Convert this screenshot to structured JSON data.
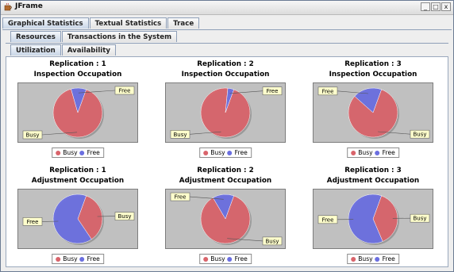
{
  "window": {
    "title": "JFrame",
    "buttons": [
      "_",
      "□",
      "x"
    ]
  },
  "tabs_level1": [
    "Graphical Statistics",
    "Textual Statistics",
    "Trace"
  ],
  "tabs_level2": [
    "Resources",
    "Transactions in the System"
  ],
  "tabs_level3": [
    "Utilization",
    "Availability"
  ],
  "colors": {
    "busy": "#d9646b",
    "free": "#6b6fe0",
    "plot_bg": "#c0c0c0"
  },
  "legend": {
    "busy": "Busy",
    "free": "Free"
  },
  "charts": [
    {
      "line1": "Replication :  1",
      "line2": "Inspection Occupation"
    },
    {
      "line1": "Replication :  2",
      "line2": "Inspection Occupation"
    },
    {
      "line1": "Replication :  3",
      "line2": "Inspection Occupation"
    },
    {
      "line1": "Replication :  1",
      "line2": "Adjustment Occupation"
    },
    {
      "line1": "Replication :  2",
      "line2": "Adjustment Occupation"
    },
    {
      "line1": "Replication :  3",
      "line2": "Adjustment Occupation"
    }
  ],
  "chart_data": [
    {
      "type": "pie",
      "title": "Inspection Occupation",
      "subtitle": "Replication :  1",
      "labels": [
        "Busy",
        "Free"
      ],
      "values": [
        90,
        10
      ]
    },
    {
      "type": "pie",
      "title": "Inspection Occupation",
      "subtitle": "Replication :  2",
      "labels": [
        "Busy",
        "Free"
      ],
      "values": [
        96,
        4
      ]
    },
    {
      "type": "pie",
      "title": "Inspection Occupation",
      "subtitle": "Replication :  3",
      "labels": [
        "Busy",
        "Free"
      ],
      "values": [
        81,
        19
      ]
    },
    {
      "type": "pie",
      "title": "Adjustment Occupation",
      "subtitle": "Replication :  1",
      "labels": [
        "Busy",
        "Free"
      ],
      "values": [
        35,
        65
      ]
    },
    {
      "type": "pie",
      "title": "Adjustment Occupation",
      "subtitle": "Replication :  2",
      "labels": [
        "Busy",
        "Free"
      ],
      "values": [
        86,
        14
      ]
    },
    {
      "type": "pie",
      "title": "Adjustment Occupation",
      "subtitle": "Replication :  3",
      "labels": [
        "Busy",
        "Free"
      ],
      "values": [
        38,
        62
      ]
    }
  ]
}
